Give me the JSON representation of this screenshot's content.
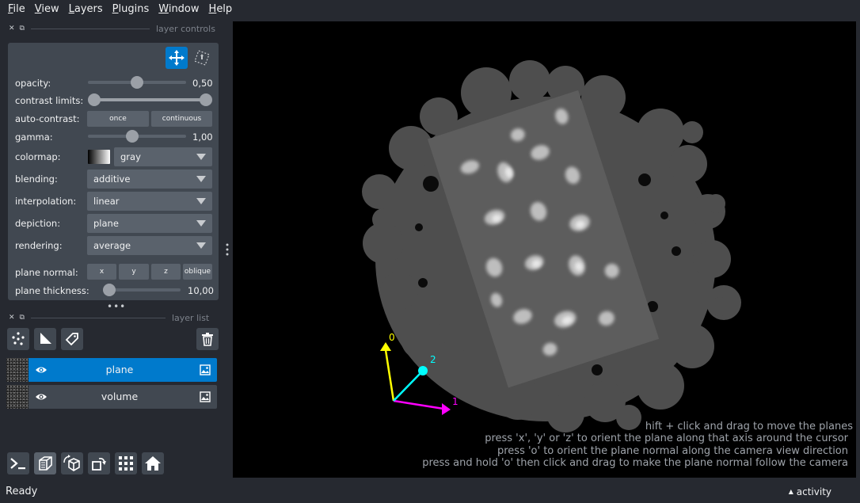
{
  "menubar": {
    "items": [
      {
        "mn": "F",
        "rest": "ile"
      },
      {
        "mn": "V",
        "rest": "iew"
      },
      {
        "mn": "L",
        "rest": "ayers"
      },
      {
        "mn": "P",
        "rest": "lugins"
      },
      {
        "mn": "W",
        "rest": "indow"
      },
      {
        "mn": "H",
        "rest": "elp"
      }
    ]
  },
  "layer_controls": {
    "title": "layer controls",
    "opacity": {
      "label": "opacity:",
      "value": "0,50",
      "fraction": 0.5
    },
    "contrast_limits": {
      "label": "contrast limits:",
      "low": 0.0,
      "high": 1.0
    },
    "auto_contrast": {
      "label": "auto-contrast:",
      "once": "once",
      "continuous": "continuous"
    },
    "gamma": {
      "label": "gamma:",
      "value": "1,00",
      "fraction": 0.45
    },
    "colormap": {
      "label": "colormap:",
      "value": "gray"
    },
    "blending": {
      "label": "blending:",
      "value": "additive"
    },
    "interpolation": {
      "label": "interpolation:",
      "value": "linear"
    },
    "depiction": {
      "label": "depiction:",
      "value": "plane"
    },
    "rendering": {
      "label": "rendering:",
      "value": "average"
    },
    "plane_normal": {
      "label": "plane normal:",
      "x": "x",
      "y": "y",
      "z": "z",
      "oblique": "oblique"
    },
    "plane_thickness": {
      "label": "plane thickness:",
      "value": "10,00",
      "fraction": 0.12
    }
  },
  "layer_list": {
    "title": "layer list",
    "layers": [
      {
        "name": "plane",
        "selected": true
      },
      {
        "name": "volume",
        "selected": false
      }
    ]
  },
  "canvas": {
    "axes": {
      "axis0": "0",
      "axis1": "1",
      "axis2": "2"
    },
    "axis_colors": {
      "axis0": "#ffff00",
      "axis1": "#ff00ff",
      "axis2": "#00ffff"
    },
    "hints": [
      "hift + click and drag to move the planes",
      "press 'x', 'y' or 'z' to orient the plane along that axis around the cursor",
      "press 'o' to orient the plane normal along the camera view direction",
      "press and hold 'o' then click and drag to make the plane normal follow the camera"
    ]
  },
  "status": {
    "text": "Ready",
    "activity": "activity"
  },
  "colors": {
    "background": "#262930",
    "panel": "#414851",
    "control": "#5a626c",
    "accent": "#007acc"
  },
  "icons": [
    "pan-zoom-icon",
    "transform-icon",
    "new-points-icon",
    "new-shapes-icon",
    "new-labels-icon",
    "delete-layer-icon",
    "eye-icon",
    "image-icon",
    "console-icon",
    "ndisplay-3d-icon",
    "roll-icon",
    "transpose-icon",
    "grid-icon",
    "home-icon"
  ]
}
